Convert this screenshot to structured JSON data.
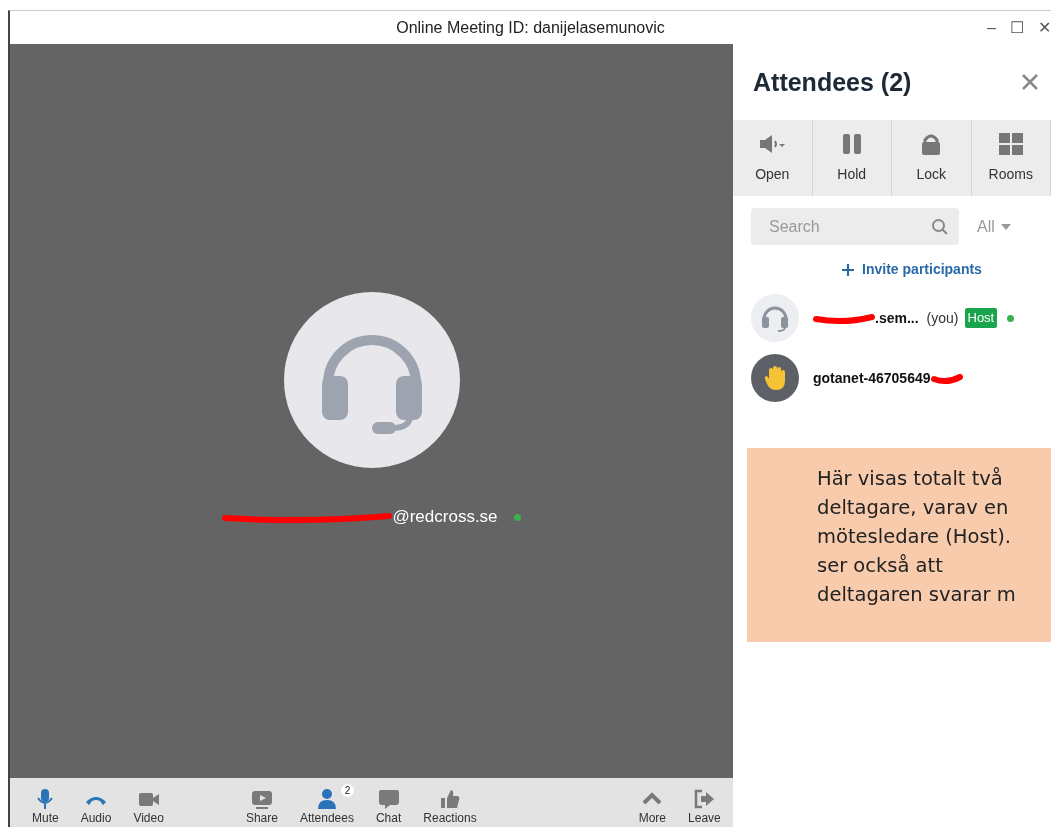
{
  "window": {
    "title": "Online Meeting ID: danijelasemunovic",
    "controls": [
      "–",
      "☐",
      "✕"
    ]
  },
  "stage": {
    "email": "@redcross.se",
    "online": true
  },
  "toolbar": [
    {
      "label": "Mute",
      "active": true
    },
    {
      "label": "Audio",
      "active": true
    },
    {
      "label": "Video",
      "active": false
    },
    {
      "label": "Share",
      "active": false
    },
    {
      "label": "Attendees",
      "active": true,
      "badge": "2"
    },
    {
      "label": "Chat",
      "active": false
    },
    {
      "label": "Reactions",
      "active": false
    },
    {
      "label": "More",
      "active": false
    },
    {
      "label": "Leave",
      "active": false
    }
  ],
  "panel": {
    "title": "Attendees (2)",
    "actions": [
      {
        "label": "Open"
      },
      {
        "label": "Hold"
      },
      {
        "label": "Lock"
      },
      {
        "label": "Rooms"
      }
    ],
    "search": {
      "placeholder": "Search"
    },
    "filter": "All",
    "invite": "Invite participants",
    "attendees": [
      {
        "name": ".sem...",
        "you": "(you)",
        "badge": "Host",
        "online": true
      },
      {
        "name": "gotanet-46705649",
        "online": false
      }
    ]
  },
  "note": {
    "lines": [
      "Här visas totalt två",
      "deltagare, varav en",
      "mötesledare (Host).",
      "ser också att",
      "deltagaren svarar m"
    ]
  }
}
